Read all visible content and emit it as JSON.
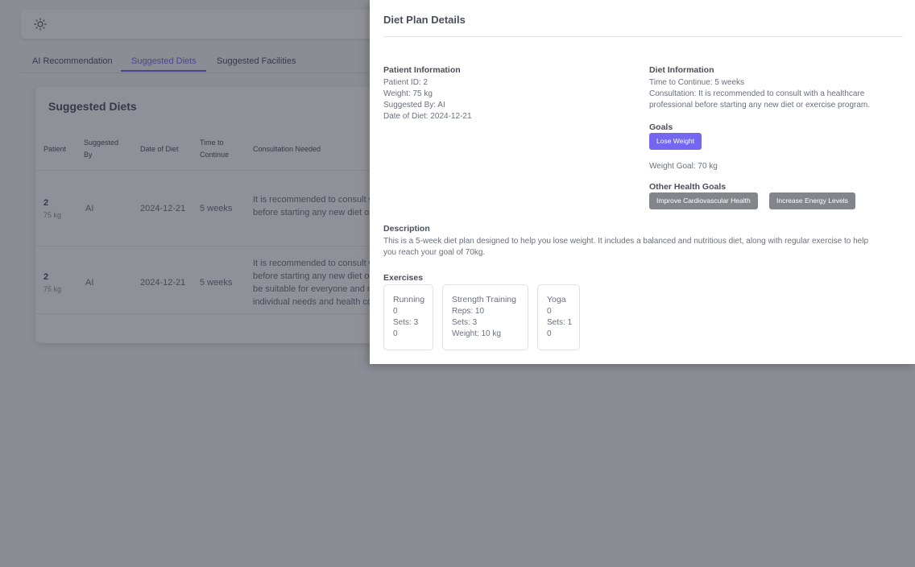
{
  "tabs": [
    "AI Recommendation",
    "Suggested Diets",
    "Suggested Facilities"
  ],
  "card": {
    "title": "Suggested Diets",
    "headers": {
      "patient": "Patient",
      "suggested_by_1": "Suggested",
      "suggested_by_2": "By",
      "date": "Date of Diet",
      "time_1": "Time to",
      "time_2": "Continue",
      "consultation": "Consultation Needed"
    },
    "rows": [
      {
        "patient_id": "2",
        "weight": "75 kg",
        "suggested_by": "AI",
        "date": "2024-12-21",
        "time": "5 weeks",
        "consult_lines": [
          "It is recommended to consult w",
          "before starting any new diet or"
        ]
      },
      {
        "patient_id": "2",
        "weight": "75 kg",
        "suggested_by": "AI",
        "date": "2024-12-21",
        "time": "5 weeks",
        "consult_lines": [
          "It is recommended to consult w",
          "before starting any new diet or",
          "be suitable for everyone and m",
          "individual needs and health co"
        ]
      }
    ]
  },
  "panel": {
    "title": "Diet Plan Details",
    "patient_info": {
      "heading": "Patient Information",
      "id": "Patient ID: 2",
      "weight": "Weight: 75 kg",
      "suggested_by": "Suggested By: AI",
      "date": "Date of Diet: 2024-12-21"
    },
    "diet_info": {
      "heading": "Diet Information",
      "time": "Time to Continue: 5 weeks",
      "consult_line1": "Consultation: It is recommended to consult with a healthcare",
      "consult_line2": "professional before starting any new diet or exercise program."
    },
    "goals": {
      "heading": "Goals",
      "primary": "Lose Weight",
      "weight_goal": "Weight Goal: 70 kg",
      "other_heading": "Other Health Goals",
      "other": [
        "Improve Cardiovascular Health",
        "Increase Energy Levels"
      ]
    },
    "description": {
      "heading": "Description",
      "line1": "This is a 5-week diet plan designed to help you lose weight. It includes a balanced and nutritious diet, along with regular exercise to help",
      "line2": "you reach your goal of 70kg."
    },
    "exercises": {
      "heading": "Exercises",
      "items": [
        {
          "name": "Running",
          "l1": "0",
          "l2": "Sets: 3",
          "l3": "0"
        },
        {
          "name": "Strength Training",
          "l1": "Reps: 10",
          "l2": "Sets: 3",
          "l3": "Weight: 10 kg"
        },
        {
          "name": "Yoga",
          "l1": "0",
          "l2": "Sets: 1",
          "l3": "0"
        }
      ]
    }
  },
  "colors": {
    "accent": "#7367f0",
    "secondary_badge": "#82868b"
  }
}
